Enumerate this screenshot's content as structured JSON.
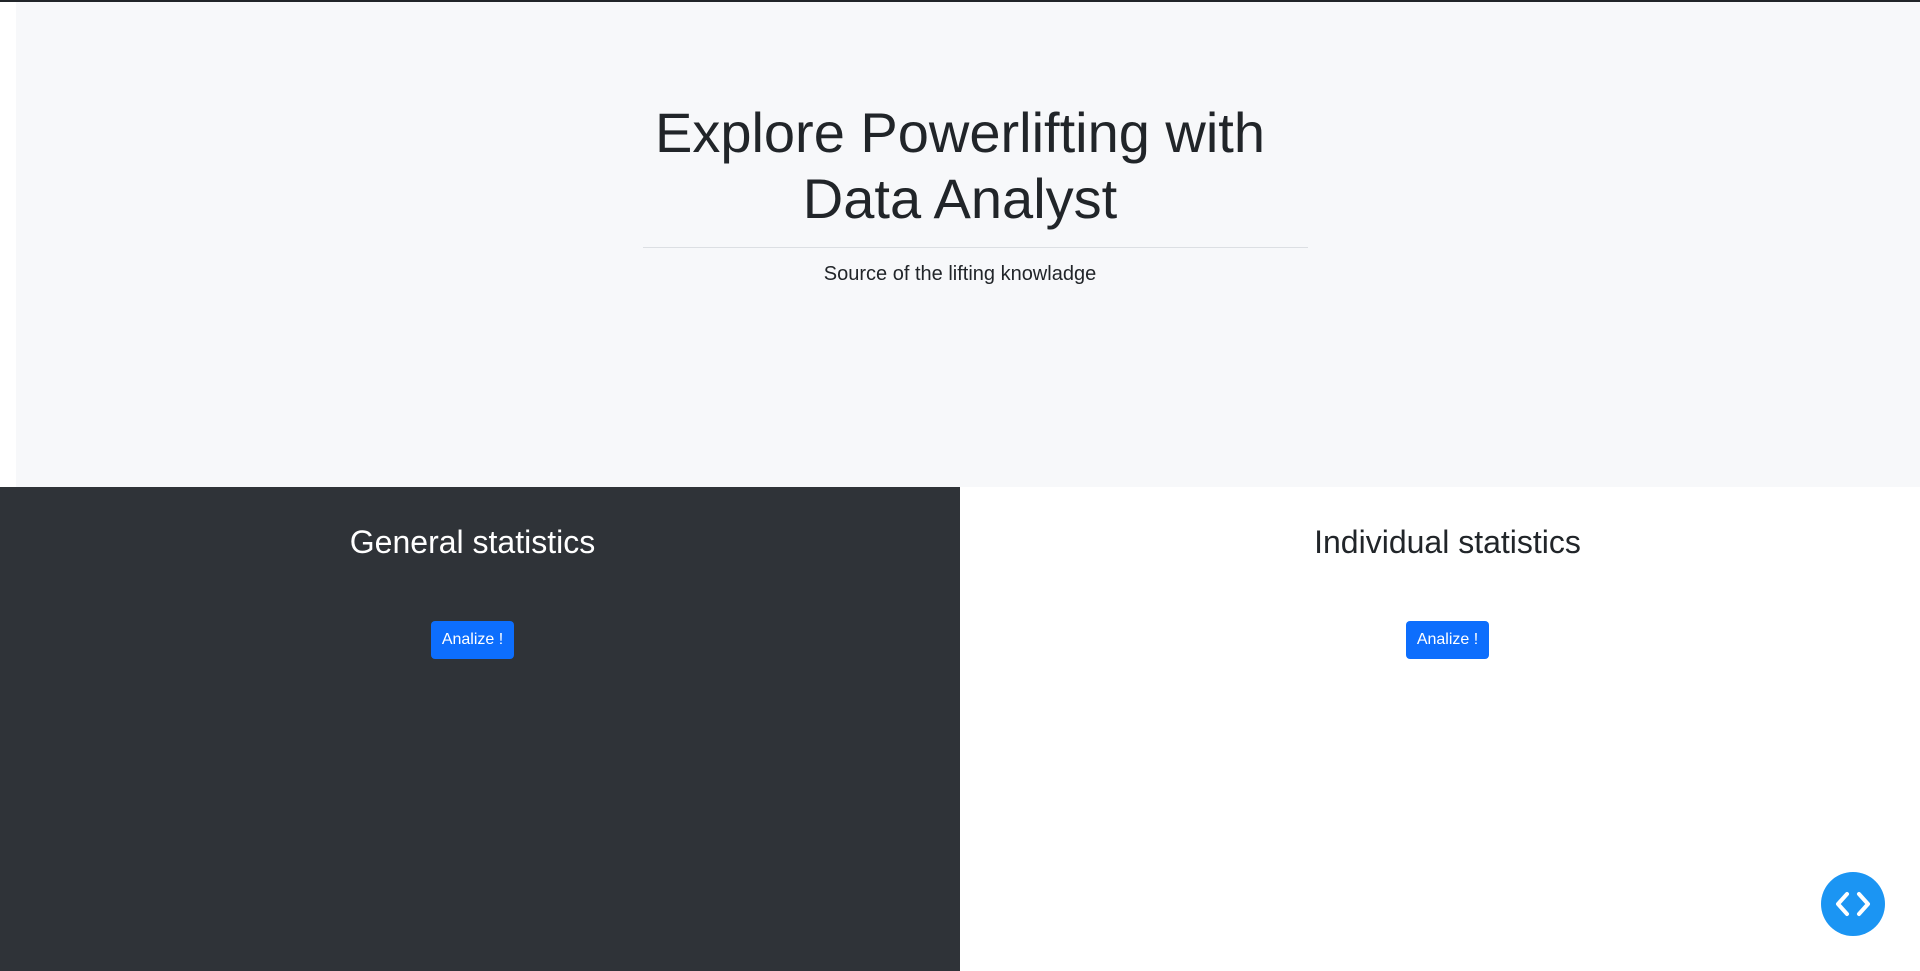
{
  "hero": {
    "title_line1": "Explore Powerlifting with",
    "title_line2": "Data Analyst",
    "lead": "Source of the lifting knowladge"
  },
  "sections": {
    "general": {
      "title": "General statistics",
      "button_label": "Analize !"
    },
    "individual": {
      "title": "Individual statistics",
      "button_label": "Analize !"
    }
  },
  "fab": {
    "icon": "code-brackets-icon"
  },
  "colors": {
    "hero_bg": "#f7f8fa",
    "dark_panel_bg": "#2f3338",
    "light_panel_bg": "#ffffff",
    "button_bg": "#0d6efd",
    "fab_bg": "#1b95f3"
  }
}
